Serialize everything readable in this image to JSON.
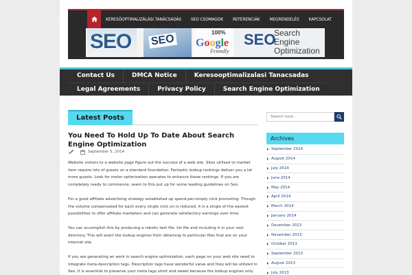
{
  "top_nav": {
    "home_icon": "home-icon",
    "items": [
      "Keresőoptimalizálási tanácsadás",
      "SEO Csomagok",
      "Referenciák",
      "Megrendelés",
      "Kapcsolat"
    ]
  },
  "banner": {
    "img1_text": "SEO",
    "img2_text": "SEO",
    "img3_percent": "100%",
    "img3_brand": "Google",
    "img3_sub": "Friendly",
    "img4_big": "SEO",
    "img4_lines": [
      "Search",
      "Engine",
      "Optimization"
    ]
  },
  "main_nav": {
    "row1": [
      "Contact Us",
      "DMCA Notice",
      "Keresooptimalizalasi Tanacsadas"
    ],
    "row2": [
      "Legal Agreements",
      "Privacy Policy",
      "Search Engine Optimization"
    ]
  },
  "latest_posts": {
    "label": "Latest Posts"
  },
  "post": {
    "title": "You Need To Hold Up To Date About Search Engine Optimization",
    "date": "September 5, 2014",
    "paragraphs": [
      "Website visitors to a website page figure out the success of a web site. Sites utilised to market item require lots of guests on a standard foundation. Fantastic lookup rankings deliver you a lot more guests. Look for motor optimization operates to enhance these rankings. If you are completely ready to commence, seem to this put up for some leading guidelines on Seo.",
      "For a good affiliate advertising strategy established up spend-per-simply click promoting. Though the volume compensated for each every single click on is reduced, it is a single of the easiest possibilities to offer affiliate marketers and can generate satisfactory earnings over time.",
      "You can accomplish this by producing a robotic text file. txt file and including it in your root directory. This will avert the lookup engines from obtaining to particular files that are on your internet site.",
      "If you are generating an work in search engine optimization, each page on your web site need to integrate meta-description tags. Description tags have wonderful value and they will be utilized in Seo. It is essential to preserve your meta tags short and sweet because the lookup engines only study a specified number of phrases in it in any case. Possessing meta tags set up will carry"
    ]
  },
  "sidebar": {
    "search_placeholder": "Search here...",
    "archives_title": "Archives",
    "archives": [
      "September 2014",
      "August 2014",
      "July 2014",
      "June 2014",
      "May 2014",
      "April 2014",
      "March 2014",
      "January 2014",
      "December 2013",
      "November 2013",
      "October 2013",
      "September 2013",
      "August 2013",
      "July 2013"
    ]
  },
  "colors": {
    "accent": "#56d9ee",
    "nav_bg": "#2f2f2f",
    "top_red": "#c8242d",
    "link_blue": "#1c4477"
  }
}
